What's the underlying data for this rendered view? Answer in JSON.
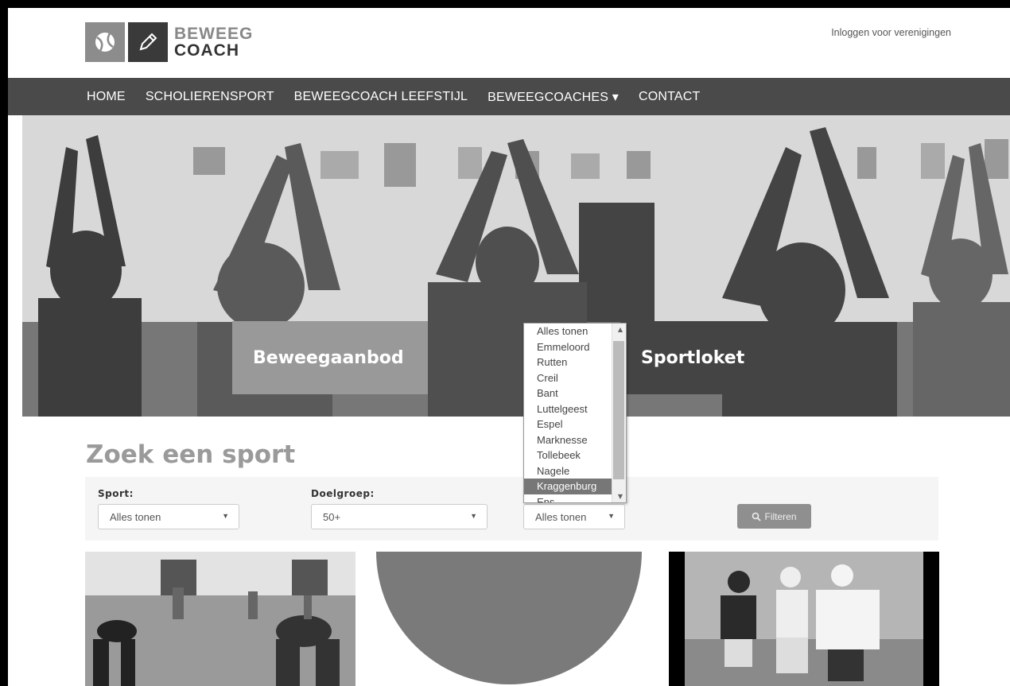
{
  "header": {
    "logo_line1": "BEWEEG",
    "logo_line2": "COACH",
    "login_link": "Inloggen voor verenigingen"
  },
  "nav": {
    "items": [
      "HOME",
      "SCHOLIERENSPORT",
      "BEWEEGCOACH LEEFSTIJL",
      "BEWEEGCOACHES ▾",
      "CONTACT"
    ]
  },
  "hero": {
    "tile_left": "Beweegaanbod",
    "tile_right": "Sportloket"
  },
  "search": {
    "title": "Zoek een sport",
    "sport_label": "Sport:",
    "sport_value": "Alles tonen",
    "doelgroep_label": "Doelgroep:",
    "doelgroep_value": "50+",
    "plaats_value": "Alles tonen",
    "filter_button": "Filteren",
    "plaats_options": [
      "Alles tonen",
      "Emmeloord",
      "Rutten",
      "Creil",
      "Bant",
      "Luttelgeest",
      "Espel",
      "Marknesse",
      "Tollebeek",
      "Nagele",
      "Kraggenburg",
      "Ens"
    ],
    "plaats_selected": "Kraggenburg"
  },
  "colors": {
    "nav_bg": "#4a4a4a",
    "tile_light": "#999999",
    "tile_dark": "#444444",
    "button": "#8f8f8f",
    "title_grey": "#9a9a9a"
  },
  "icons": [
    "tennis-ball-icon",
    "pencil-icon",
    "search-icon",
    "chevron-down-icon"
  ]
}
